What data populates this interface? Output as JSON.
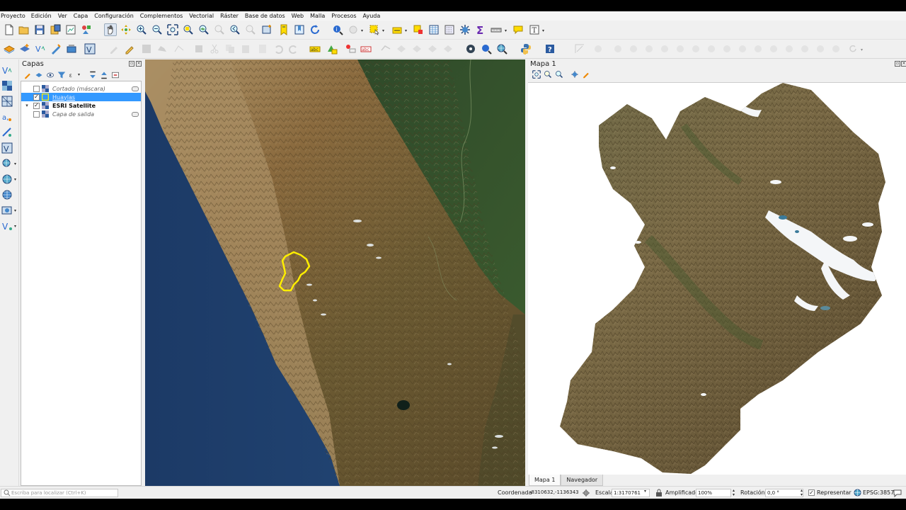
{
  "menu": [
    "Proyecto",
    "Edición",
    "Ver",
    "Capa",
    "Configuración",
    "Complementos",
    "Vectorial",
    "Ráster",
    "Base de datos",
    "Web",
    "Malla",
    "Procesos",
    "Ayuda"
  ],
  "layers_panel": {
    "title": "Capas",
    "layers": [
      {
        "name": "Cortado (máscara)",
        "checked": false,
        "expanded": null
      },
      {
        "name": "Huaylas",
        "checked": true,
        "expanded": null
      },
      {
        "name": "ESRI Satellite",
        "checked": true,
        "expanded": true
      },
      {
        "name": "Capa de salida",
        "checked": false,
        "expanded": null
      }
    ]
  },
  "map_view": {
    "title": "Mapa 1",
    "tabs": [
      "Mapa 1",
      "Navegador"
    ]
  },
  "status": {
    "locator_placeholder": "Escriba para localizar (Ctrl+K)",
    "coord_label": "Coordenada",
    "coord_value": "-8310632,-1136343",
    "scale_label": "Escala",
    "scale_value": "1:3170761",
    "magnifier_label": "Amplificador",
    "magnifier_value": "100%",
    "rotation_label": "Rotación",
    "rotation_value": "0,0 °",
    "render_label": "Representar",
    "crs": "EPSG:3857"
  },
  "colors": {
    "selection": "#3399ff",
    "outline": "#ffee00",
    "ocean": "#1f3f6b"
  }
}
